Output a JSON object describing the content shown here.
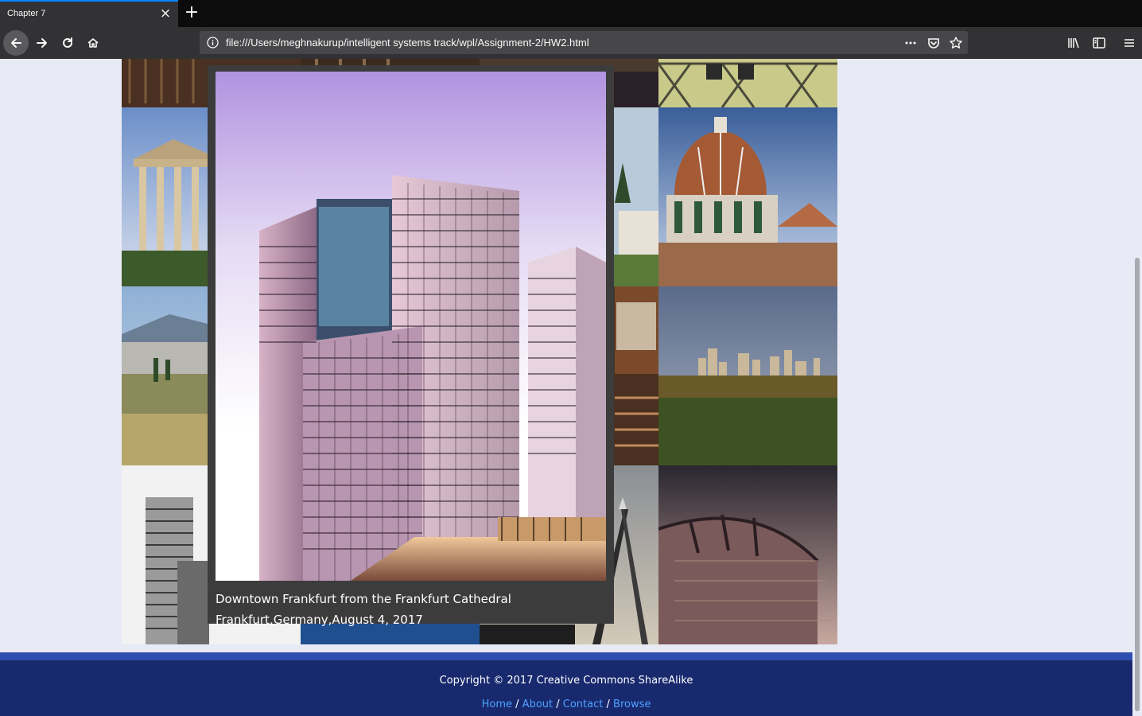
{
  "browser": {
    "tab_title": "Chapter 7",
    "url": "file:///Users/meghnakurup/intelligent systems track/wpl/Assignment-2/HW2.html",
    "accent_color": "#0a84ff"
  },
  "lightbox": {
    "caption_title": "Downtown Frankfurt from the Frankfurt Cathedral",
    "caption_detail": "Frankfurt,Germany,August 4, 2017"
  },
  "footer": {
    "copyright": "Copyright © 2017 Creative Commons ShareAlike",
    "separator": "/",
    "links": [
      {
        "label": "Home"
      },
      {
        "label": "About"
      },
      {
        "label": "Contact"
      },
      {
        "label": "Browse"
      }
    ],
    "bg_color": "#18296e",
    "link_color": "#4ea2ff"
  }
}
